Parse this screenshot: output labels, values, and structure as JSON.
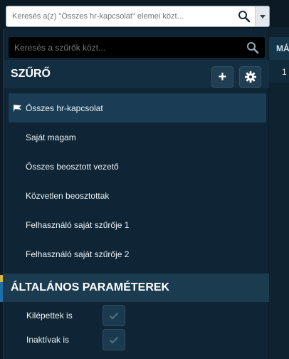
{
  "top_search": {
    "placeholder": "Keresés a(z) \"Összes hr-kapcsolat\" elemei közt..."
  },
  "background": {
    "column_header": "MÁ",
    "cell_value": "1"
  },
  "filter_panel": {
    "search_placeholder": "Keresés a szűrők közt...",
    "filter_section_title": "SZŰRŐ",
    "add_label": "+",
    "filters": [
      {
        "label": "Összes hr-kapcsolat",
        "active": true
      },
      {
        "label": "Saját magam",
        "active": false
      },
      {
        "label": "Összes beosztott vezető",
        "active": false
      },
      {
        "label": "Közvetlen beosztottak",
        "active": false
      },
      {
        "label": "Felhasználó saját szűrője 1",
        "active": false
      },
      {
        "label": "Felhasználó saját szűrője 2",
        "active": false
      }
    ],
    "params_section_title": "ÁLTALÁNOS PARAMÉTEREK",
    "params": [
      {
        "label": "Kilépettek is"
      },
      {
        "label": "Inaktívak is"
      }
    ]
  },
  "colors": {
    "panel_bg": "#0f2535",
    "active_item_bg": "#1b3c55",
    "accent_yellow": "#d7b73d",
    "accent_blue": "#1f6fa8"
  },
  "icons": [
    "search-icon",
    "chevron-down-icon",
    "plus-icon",
    "gear-icon",
    "flag-icon",
    "check-icon"
  ]
}
